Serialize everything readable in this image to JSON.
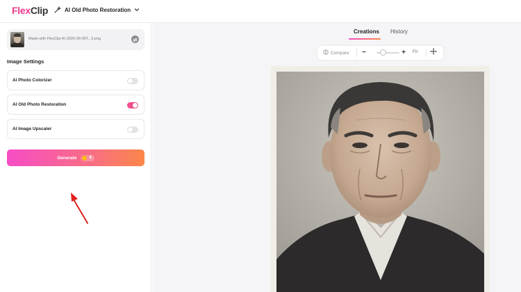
{
  "header": {
    "logo_part1": "Flex",
    "logo_part2": "Clip",
    "tool_name": "AI Old Photo Restoration"
  },
  "sidebar": {
    "file": {
      "name": "Made with FlexClip AI-2026-06-05T...3.png"
    },
    "section_title": "Image Settings",
    "options": [
      {
        "label": "AI Photo Colorizer",
        "enabled": false
      },
      {
        "label": "AI Old Photo Restoration",
        "enabled": true
      },
      {
        "label": "AI Image Upscaler",
        "enabled": false
      }
    ],
    "generate": {
      "label": "Generate",
      "credits": "4"
    }
  },
  "main": {
    "tabs": [
      {
        "label": "Creations",
        "active": true
      },
      {
        "label": "History",
        "active": false
      }
    ],
    "toolbar": {
      "compare_label": "Compare",
      "fit_label": "Fit",
      "zoom_out": "−",
      "zoom_in": "+"
    }
  },
  "colors": {
    "brand_pink": "#f0378b",
    "toggle_on": "#f0508e",
    "generate_gradient_start": "#f64cc6",
    "generate_gradient_end": "#fb8748",
    "annotation_arrow": "#e02020"
  }
}
